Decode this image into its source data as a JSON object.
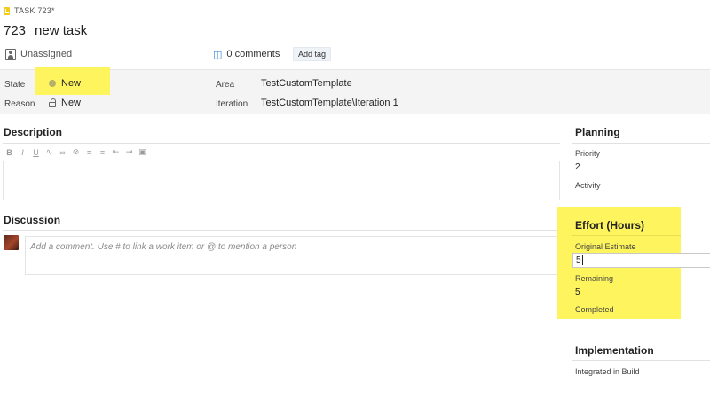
{
  "header": {
    "type_label": "TASK 723*",
    "id": "723",
    "title": "new task",
    "assignee": "Unassigned",
    "comments": "0 comments",
    "add_tag": "Add tag"
  },
  "fields": {
    "state_label": "State",
    "state_value": "New",
    "reason_label": "Reason",
    "reason_value": "New",
    "area_label": "Area",
    "area_value": "TestCustomTemplate",
    "iteration_label": "Iteration",
    "iteration_value": "TestCustomTemplate\\Iteration 1"
  },
  "description": {
    "title": "Description",
    "toolbar": [
      "bold-icon",
      "italic-icon",
      "underline-icon",
      "highlight-icon",
      "link-icon",
      "unlink-icon",
      "bullets-icon",
      "numbering-icon",
      "outdent-icon",
      "indent-icon",
      "image-icon"
    ]
  },
  "discussion": {
    "title": "Discussion",
    "placeholder": "Add a comment. Use # to link a work item or @ to mention a person"
  },
  "planning": {
    "title": "Planning",
    "priority_label": "Priority",
    "priority_value": "2",
    "activity_label": "Activity",
    "activity_value": ""
  },
  "effort": {
    "title": "Effort (Hours)",
    "original_estimate_label": "Original Estimate",
    "original_estimate_value": "5",
    "remaining_label": "Remaining",
    "remaining_value": "5",
    "completed_label": "Completed"
  },
  "implementation": {
    "title": "Implementation",
    "integrated_label": "Integrated in Build"
  },
  "colors": {
    "highlight": "#fdf45e",
    "task_icon": "#f2cb1d",
    "state_new": "#b2b06a",
    "comment_icon": "#2a7fd1"
  }
}
